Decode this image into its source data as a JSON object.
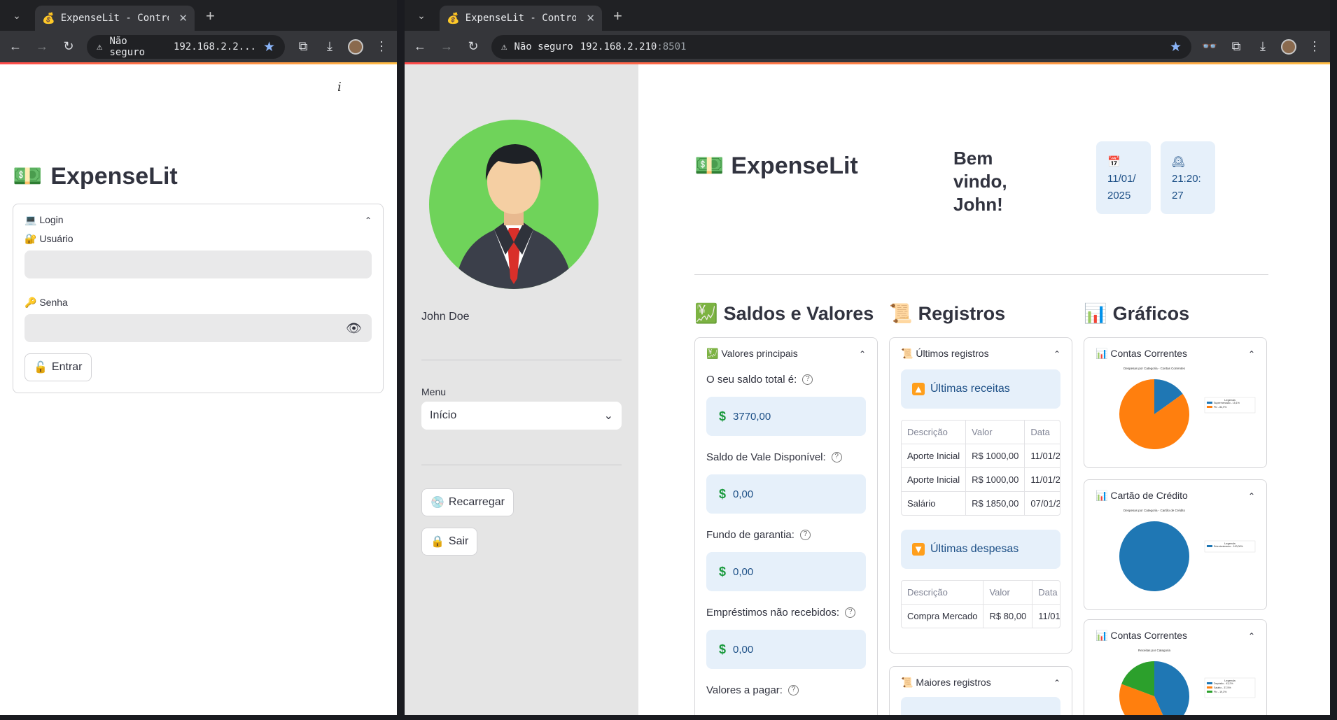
{
  "left_window": {
    "tab_title": "ExpenseLit - Controle",
    "address_warning": "Não seguro",
    "address_url": "192.168.2.2...",
    "app_title": "ExpenseLit",
    "login": {
      "header": "Login",
      "user_label": "Usuário",
      "password_label": "Senha",
      "submit_label": "Entrar"
    }
  },
  "right_window": {
    "tab_title": "ExpenseLit - Controle",
    "address_warning": "Não seguro",
    "address_host": "192.168.2.210",
    "address_port": ":8501",
    "sidebar": {
      "user_name": "John Doe",
      "menu_label": "Menu",
      "menu_value": "Início",
      "reload_label": "Recarregar",
      "logout_label": "Sair"
    },
    "header": {
      "app_title": "ExpenseLit",
      "welcome": "Bem vindo, John!",
      "date_line1": "11/01/",
      "date_line2": "2025",
      "time_line1": "21:20:",
      "time_line2": "27"
    },
    "sections": {
      "balances": "Saldos e Valores",
      "records": "Registros",
      "charts": "Gráficos"
    },
    "balances": {
      "expander": "Valores principais",
      "items": [
        {
          "label": "O seu saldo total é:",
          "value": "3770,00"
        },
        {
          "label": "Saldo de Vale Disponível:",
          "value": "0,00"
        },
        {
          "label": "Fundo de garantia:",
          "value": "0,00"
        },
        {
          "label": "Empréstimos não recebidos:",
          "value": "0,00"
        },
        {
          "label": "Valores a pagar:",
          "value": ""
        }
      ]
    },
    "records": {
      "expander": "Últimos registros",
      "income_title": "Últimas receitas",
      "income_headers": [
        "Descrição",
        "Valor",
        "Data"
      ],
      "income_rows": [
        [
          "Aporte Inicial",
          "R$ 1000,00",
          "11/01/2"
        ],
        [
          "Aporte Inicial",
          "R$ 1000,00",
          "11/01/2"
        ],
        [
          "Salário",
          "R$ 1850,00",
          "07/01/2"
        ]
      ],
      "expense_title": "Últimas despesas",
      "expense_headers": [
        "Descrição",
        "Valor",
        "Data"
      ],
      "expense_rows": [
        [
          "Compra Mercado",
          "R$ 80,00",
          "11/01,"
        ]
      ],
      "largest_expander": "Maiores registros"
    },
    "charts": {
      "checking": {
        "expander": "Contas Correntes",
        "subtitle": "Despesas por Categoria - Contas Correntes",
        "legend_title": "Legenda",
        "legend": [
          {
            "label": "Supermercado - 15,1%",
            "color": "#1f77b4"
          },
          {
            "label": "Pix - 84,9%",
            "color": "#ff7f0e"
          }
        ]
      },
      "credit": {
        "expander": "Cartão de Crédito",
        "subtitle": "Despesas por Categoria - Cartão de Crédito",
        "legend_title": "Legenda",
        "legend": [
          {
            "label": "Entretenimento - 100,00%",
            "color": "#1f77b4"
          }
        ]
      },
      "checking_income": {
        "expander": "Contas Correntes",
        "subtitle": "Receitas por Categoria",
        "legend_title": "Legenda",
        "legend": [
          {
            "label": "Depósito - 43,2%",
            "color": "#1f77b4"
          },
          {
            "label": "Salário - 37,5%",
            "color": "#ff7f0e"
          },
          {
            "label": "Pix - 19,3%",
            "color": "#2ca02c"
          }
        ]
      }
    }
  },
  "chart_data": [
    {
      "type": "pie",
      "title": "Despesas por Categoria - Contas Correntes",
      "categories": [
        "Supermercado",
        "Pix"
      ],
      "values": [
        15.1,
        84.9
      ]
    },
    {
      "type": "pie",
      "title": "Despesas por Categoria - Cartão de Crédito",
      "categories": [
        "Entretenimento"
      ],
      "values": [
        100
      ]
    },
    {
      "type": "pie",
      "title": "Receitas por Categoria",
      "categories": [
        "Depósito",
        "Salário",
        "Pix"
      ],
      "values": [
        43.2,
        37.5,
        19.3
      ]
    }
  ]
}
